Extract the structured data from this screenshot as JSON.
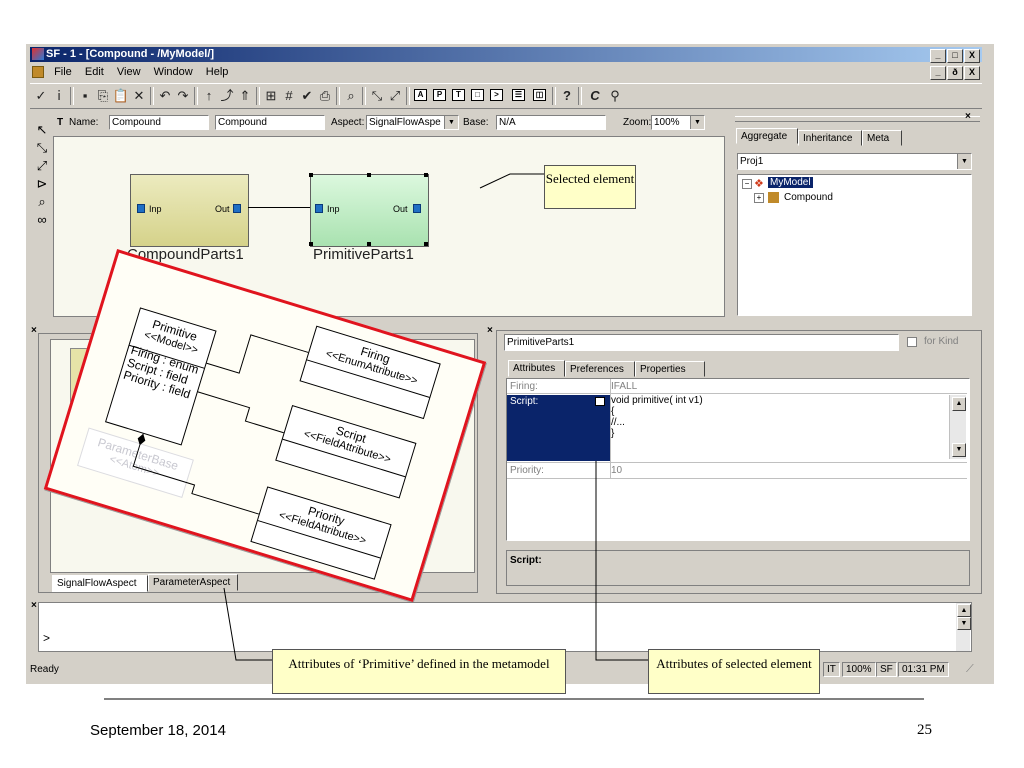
{
  "window": {
    "title": "SF - 1 - [Compound - /MyModel/]",
    "controls_outer": [
      "_",
      "□",
      "X"
    ],
    "controls_inner": [
      "_",
      "ð",
      "X"
    ]
  },
  "menu": [
    "File",
    "Edit",
    "View",
    "Window",
    "Help"
  ],
  "attribute_bar": {
    "name_label": "Name:",
    "name_value": "Compound",
    "kind_value": "Compound",
    "aspect_label": "Aspect:",
    "aspect_value": "SignalFlowAspe",
    "base_label": "Base:",
    "base_value": "N/A",
    "zoom_label": "Zoom:",
    "zoom_value": "100%"
  },
  "diagram": {
    "block1": {
      "name": "CompoundParts1",
      "in_port": "Inp",
      "out_port": "Out"
    },
    "block2": {
      "name": "PrimitiveParts1",
      "in_port": "Inp",
      "out_port": "Out"
    },
    "callout_selected": "Selected element"
  },
  "browser": {
    "tabs": [
      "Aggregate",
      "Inheritance",
      "Meta"
    ],
    "project": "Proj1",
    "tree": [
      {
        "label": "MyModel",
        "icon": "model-icon"
      },
      {
        "label": "Compound",
        "icon": "compound-icon"
      }
    ]
  },
  "lower_left": {
    "tabs": [
      "SignalFlowAspect",
      "ParameterAspect"
    ]
  },
  "metamodel_overlay": {
    "primitive": {
      "name": "Primitive",
      "stereotype": "<<Model>>",
      "attrs": [
        "Firing : enum",
        "Script : field",
        "Priority : field"
      ]
    },
    "firing": {
      "name": "Firing",
      "stereotype": "<<EnumAttribute>>"
    },
    "script": {
      "name": "Script",
      "stereotype": "<<FieldAttribute>>"
    },
    "priority": {
      "name": "Priority",
      "stereotype": "<<FieldAttribute>>"
    },
    "parameter_base": {
      "name": "ParameterBase",
      "stereotype": "<<Atom>>"
    }
  },
  "object_inspector": {
    "name": "PrimitiveParts1",
    "for_kind_label": "for Kind",
    "tabs": [
      "Attributes",
      "Preferences",
      "Properties"
    ],
    "rows": [
      {
        "label": "Firing:",
        "value": "IFALL"
      },
      {
        "label": "Script:",
        "value_lines": [
          "void primitive( int v1)",
          "{",
          "//...",
          "}"
        ]
      },
      {
        "label": "Priority:",
        "value": "10"
      }
    ],
    "help_label": "Script:"
  },
  "console": {
    "prompt": ">"
  },
  "status": {
    "left": "Ready",
    "boxes": [
      "IT",
      "100%",
      "SF",
      "01:31 PM"
    ]
  },
  "callouts": {
    "primitive_attrs": "Attributes of ‘Primitive’ defined in the metamodel",
    "selected_attrs": "Attributes of selected element"
  },
  "footer": {
    "date": "September 18, 2014",
    "page": "25"
  },
  "colors": {
    "titlebar_start": "#0a246a",
    "titlebar_end": "#a6caf0",
    "block1_fill": "#e6e3a8",
    "block2_fill": "#c9f2cd",
    "overlay_border": "#e0141e",
    "port": "#1f6fc4",
    "selection": "#0a246a"
  }
}
